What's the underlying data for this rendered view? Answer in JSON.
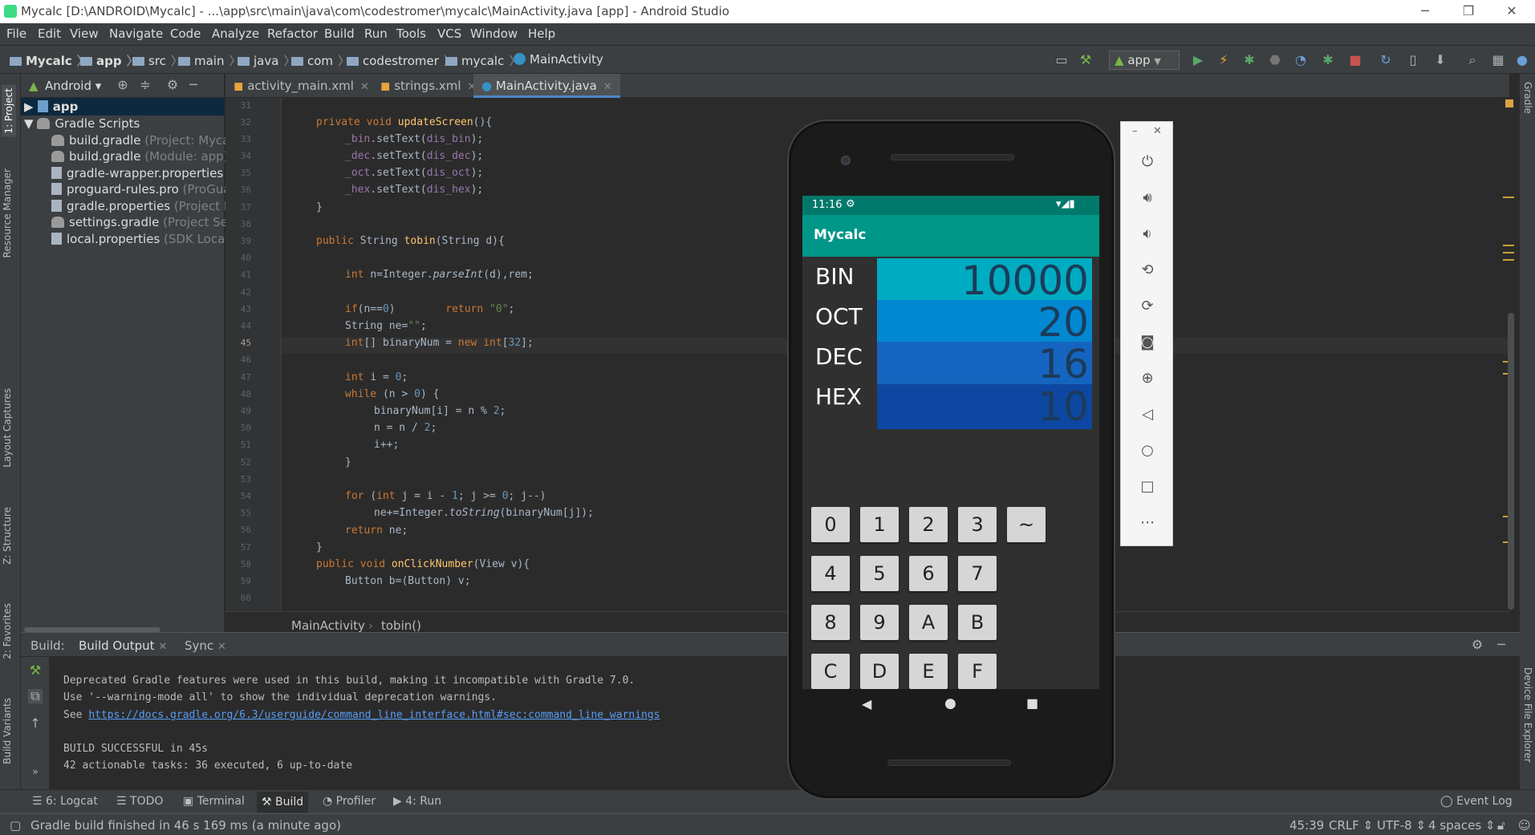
{
  "window": {
    "title": "Mycalc [D:\\ANDROID\\Mycalc] - ...\\app\\src\\main\\java\\com\\codestromer\\mycalc\\MainActivity.java [app] - Android Studio"
  },
  "menu": [
    "File",
    "Edit",
    "View",
    "Navigate",
    "Code",
    "Analyze",
    "Refactor",
    "Build",
    "Run",
    "Tools",
    "VCS",
    "Window",
    "Help"
  ],
  "breadcrumb": [
    "Mycalc",
    "app",
    "src",
    "main",
    "java",
    "com",
    "codestromer",
    "mycalc",
    "MainActivity"
  ],
  "run_config": "app",
  "left_stripe": [
    "1: Project",
    "Resource Manager",
    "Layout Captures",
    "Z: Structure",
    "2: Favorites",
    "Build Variants"
  ],
  "right_stripe": [
    "Gradle",
    "Device File Explorer"
  ],
  "project": {
    "view": "Android",
    "items": [
      {
        "name": "app",
        "hint": ""
      },
      {
        "name": "Gradle Scripts",
        "hint": ""
      },
      {
        "name": "build.gradle",
        "hint": "(Project: Mycal"
      },
      {
        "name": "build.gradle",
        "hint": "(Module: app)"
      },
      {
        "name": "gradle-wrapper.properties",
        "hint": ""
      },
      {
        "name": "proguard-rules.pro",
        "hint": "(ProGua"
      },
      {
        "name": "gradle.properties",
        "hint": "(Project P"
      },
      {
        "name": "settings.gradle",
        "hint": "(Project Sett"
      },
      {
        "name": "local.properties",
        "hint": "(SDK Locat"
      }
    ]
  },
  "tabs": [
    "activity_main.xml",
    "strings.xml",
    "MainActivity.java"
  ],
  "editor": {
    "line_numbers": [
      "31",
      "32",
      "33",
      "34",
      "35",
      "36",
      "37",
      "38",
      "39",
      "40",
      "41",
      "42",
      "43",
      "44",
      "45",
      "46",
      "47",
      "48",
      "49",
      "50",
      "51",
      "52",
      "53",
      "54",
      "55",
      "56",
      "57",
      "58",
      "59",
      "60"
    ],
    "crumb": [
      "MainActivity",
      "tobin()"
    ]
  },
  "build": {
    "header": "Build:",
    "tabs": [
      "Build Output",
      "Sync"
    ],
    "lines": [
      "Deprecated Gradle features were used in this build, making it incompatible with Gradle 7.0.",
      "Use '--warning-mode all' to show the individual deprecation warnings.",
      "See ",
      "BUILD SUCCESSFUL in 45s",
      "42 actionable tasks: 36 executed, 6 up-to-date"
    ],
    "link": "https://docs.gradle.org/6.3/userguide/command_line_interface.html#sec:command_line_warnings"
  },
  "bottom_tabs": [
    "6: Logcat",
    "TODO",
    "Terminal",
    "Build",
    "Profiler",
    "4: Run",
    "Event Log"
  ],
  "status": {
    "message": "Gradle build finished in 46 s 169 ms (a minute ago)",
    "position": "45:39",
    "line_sep": "CRLF",
    "encoding": "UTF-8",
    "indent": "4 spaces"
  },
  "phone": {
    "time": "11:16",
    "app_title": "Mycalc",
    "rows": [
      {
        "label": "BIN",
        "value": "10000",
        "color": "#00acc1"
      },
      {
        "label": "OCT",
        "value": "20",
        "color": "#0288d1"
      },
      {
        "label": "DEC",
        "value": "16",
        "color": "#1565c0"
      },
      {
        "label": "HEX",
        "value": "10",
        "color": "#0d47a1"
      }
    ],
    "keys": [
      [
        "0",
        "1",
        "2",
        "3",
        "~"
      ],
      [
        "4",
        "5",
        "6",
        "7"
      ],
      [
        "8",
        "9",
        "A",
        "B"
      ],
      [
        "C",
        "D",
        "E",
        "F"
      ]
    ]
  },
  "emulator_controls": [
    "power-icon",
    "volume-up-icon",
    "volume-down-icon",
    "rotate-left-icon",
    "rotate-right-icon",
    "camera-icon",
    "zoom-icon",
    "back-icon",
    "home-icon",
    "overview-icon",
    "more-icon"
  ]
}
